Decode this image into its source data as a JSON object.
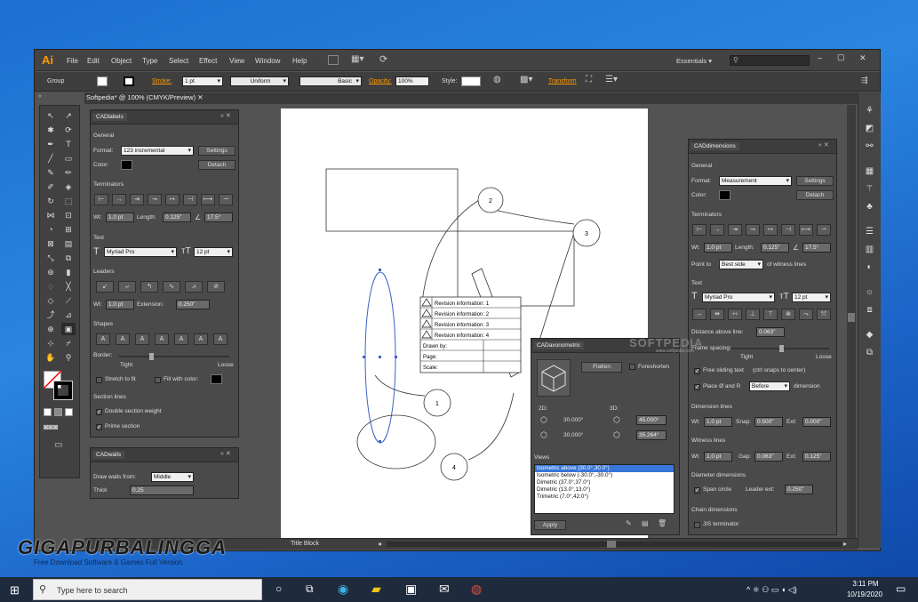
{
  "window": {
    "app_logo": "Ai",
    "menus": [
      "File",
      "Edit",
      "Object",
      "Type",
      "Select",
      "Effect",
      "View",
      "Window",
      "Help"
    ],
    "workspace": "Essentials",
    "search_placeholder": "",
    "minimize": "‒",
    "maximize": "▢",
    "close": "✕"
  },
  "control_bar": {
    "selection": "Group",
    "stroke_label": "Stroke:",
    "stroke_value": "1 pt",
    "profile": "Uniform",
    "brush": "Basic",
    "opacity_label": "Opacity:",
    "opacity_value": "100%",
    "style_label": "Style:",
    "transform_label": "Transform"
  },
  "document": {
    "tab_title": "Softpedia* @ 100% (CMYK/Preview)",
    "tab_close": "✕",
    "status_text": "Title Block"
  },
  "cadlabels": {
    "title": "CADlabels",
    "general": "General",
    "format_label": "Format:",
    "format_value": "123 incremental",
    "settings": "Settings",
    "color_label": "Color:",
    "detach": "Detach",
    "terminators": "Terminators",
    "wt_label": "Wt:",
    "wt_value": "1.0 pt",
    "length_label": "Length:",
    "length_value": "0.125\"",
    "angle_value": "17.5°",
    "text": "Text",
    "font_value": "Myriad Pro",
    "size_value": "12 pt",
    "leaders": "Leaders",
    "leader_wt": "1.0 pt",
    "extension_label": "Extension:",
    "extension_value": "0.250\"",
    "shapes": "Shapes",
    "shape_glyphs": [
      "A",
      "A",
      "A",
      "A",
      "A",
      "A",
      "A"
    ],
    "border_label": "Border:",
    "tight": "Tight",
    "loose": "Loose",
    "stretch": "Stretch to fit",
    "fill_color": "Fill with color:",
    "section_lines": "Section lines",
    "double_weight": "Double section weight",
    "prime_section": "Prime section"
  },
  "cadwalls": {
    "title": "CADwalls",
    "draw_from_label": "Draw walls from:",
    "draw_from_value": "Middle",
    "thickness_label": "Thick",
    "thickness_value": "0.25"
  },
  "caddimensions": {
    "title": "CADdimensions",
    "general": "General",
    "format_label": "Format:",
    "format_value": "Measurement",
    "settings": "Settings",
    "color_label": "Color:",
    "detach": "Detach",
    "terminators": "Terminators",
    "wt_label": "Wt:",
    "wt_value": "1.0 pt",
    "length_label": "Length:",
    "length_value": "0.125\"",
    "angle_value": "17.5°",
    "point_to_label": "Point to",
    "point_to_value": "Best side",
    "witness_suffix": "of witness lines",
    "text": "Text",
    "font_value": "Myriad Pro",
    "size_value": "12 pt",
    "distance_label": "Distance above line:",
    "distance_value": "0.063\"",
    "frame_spacing": "Frame spacing:",
    "tight": "Tight",
    "loose": "Loose",
    "free_sliding": "Free sliding text",
    "ctrl_hint": "(ctrl snaps to center)",
    "place_label": "Place Ø and R",
    "place_value": "Before",
    "dimension": "dimension",
    "dimension_lines": "Dimension lines",
    "dl_wt": "1.0 pt",
    "snap_label": "Snap:",
    "snap_value": "0.500\"",
    "ext_label": "Ext:",
    "ext_value": "0.000\"",
    "witness_lines": "Witness lines",
    "wl_wt": "1.0 pt",
    "gap_label": "Gap:",
    "gap_value": "0.063\"",
    "wl_ext_value": "0.125\"",
    "diameter_dims": "Diameter dimensions",
    "span_circle": "Span circle",
    "leader_ext_label": "Leader ext:",
    "leader_ext_value": "0.250\"",
    "chain_dims": "Chain dimensions",
    "jis": "JIS terminator"
  },
  "cadaxonometric": {
    "title": "CADaxonometric",
    "flatten": "Flatten",
    "foreshorten": "Foreshorten",
    "label_2d": "2D:",
    "label_3d": "3D:",
    "angle1": "30.000°",
    "angle2": "30.000°",
    "angle3": "45.000°",
    "angle4": "35.264°",
    "views_label": "Views",
    "views": [
      "Isometric above (30.0°,30.0°)",
      "Isometric below (-30.0°,-30.0°)",
      "Dimetric (37.0°,37.0°)",
      "Dimetric (13.0°,13.0°)",
      "Trimetric (7.0°,42.0°)"
    ],
    "apply": "Apply"
  },
  "drawing": {
    "balloons": [
      "1",
      "2",
      "3",
      "4"
    ],
    "revision_rows": [
      "Revision information: 1",
      "Revision information: 2",
      "Revision information: 3",
      "Revision information: 4"
    ],
    "title_rows": [
      "Drawn by:",
      "Page:",
      "Scale:"
    ],
    "softpedia": "SOFTPEDIA",
    "softpedia_url": "www.softpedia.com"
  },
  "watermark": {
    "title": "GIGAPURBALINGGA",
    "subtitle": "Free Download Software & Games Full Version"
  },
  "taskbar": {
    "search_placeholder": "Type here to search",
    "time": "3:11 PM",
    "date": "10/19/2020"
  },
  "colors": {
    "accent_orange": "#ff9a00",
    "panel_bg": "#4a4a4a",
    "app_bg": "#535353",
    "desktop": "#1d6fd1"
  }
}
